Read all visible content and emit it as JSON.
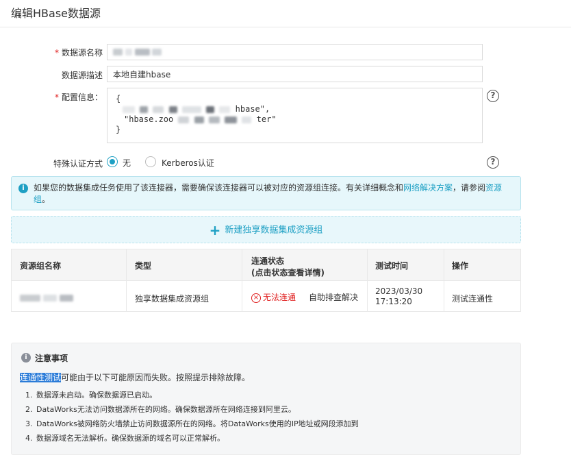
{
  "page_title": "编辑HBase数据源",
  "form": {
    "name_label": "数据源名称",
    "desc_label": "数据源描述",
    "desc_value": "本地自建hbase",
    "config_label": "配置信息：",
    "config_lines": {
      "l1": "{",
      "l2_tail": "hbase\",",
      "l3_head": "\"hbase.zoo",
      "l3_tail": "ter\"",
      "l4": "}"
    },
    "auth_label": "特殊认证方式",
    "auth_options": {
      "none": "无",
      "kerberos": "Kerberos认证"
    },
    "help_glyph": "?"
  },
  "info": {
    "text_part1": "如果您的数据集成任务使用了该连接器，需要确保该连接器可以被对应的资源组连接。有关详细概念和",
    "link1": "网络解决方案",
    "text_part2": "，请参阅",
    "link2": "资源组",
    "text_part3": "。"
  },
  "new_group_label": "新建独享数据集成资源组",
  "table": {
    "headers": {
      "name": "资源组名称",
      "type": "类型",
      "status_line1": "连通状态",
      "status_line2": "(点击状态查看详情)",
      "time": "测试时间",
      "action": "操作"
    },
    "row": {
      "type": "独享数据集成资源组",
      "status": "无法连通",
      "self_check": "自助排查解决",
      "time_date": "2023/03/30",
      "time_clock": "17:13:20",
      "action": "测试连通性"
    }
  },
  "notes": {
    "title": "注意事项",
    "intro_highlight": "连通性测试",
    "intro_rest": "可能由于以下可能原因而失败。按照提示排除故障。",
    "items": [
      {
        "num": "1.",
        "text": "数据源未启动。确保数据源已启动。"
      },
      {
        "num": "2.",
        "text": "DataWorks无法访问数据源所在的网络。确保数据源所在网络连接到阿里云。"
      },
      {
        "num": "3.",
        "text": "DataWorks被网络防火墙禁止访问数据源所在的网络。将DataWorks使用的IP地址或网段添加到"
      },
      {
        "num": "4.",
        "text": "数据源域名无法解析。确保数据源的域名可以正常解析。"
      }
    ]
  },
  "colors": {
    "accent": "#1ea0c4",
    "error": "#e02020"
  }
}
